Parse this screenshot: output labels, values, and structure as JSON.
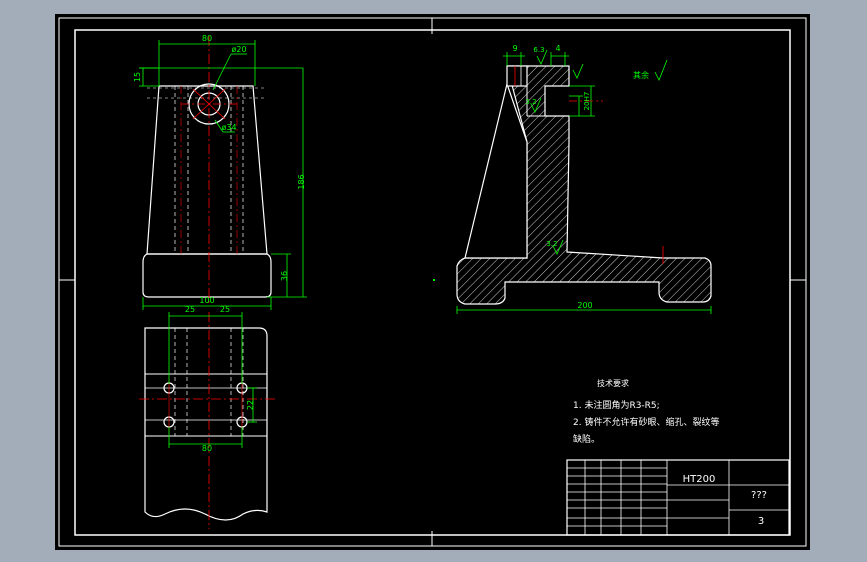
{
  "colors": {
    "background": "#000000",
    "app_background": "#a3acb9",
    "outline": "#ffffff",
    "dimension": "#00ff00",
    "centerline": "#ff0000",
    "hidden_line": "#ffffff"
  },
  "front_view": {
    "dim_top_width": "80",
    "dim_hole": "ø20",
    "dim_left_height": "15",
    "dim_inner_hole": "ø34",
    "dim_total_height": "186",
    "dim_base_height": "36",
    "dim_base_width": "100"
  },
  "top_view": {
    "dim_left": "25",
    "dim_right": "25",
    "dim_right_vertical": "22",
    "dim_bottom": "80"
  },
  "section_view": {
    "dim_9": "9",
    "dim_63": "6.3",
    "dim_4": "4",
    "dim_32_upper": "3.2",
    "dim_20": "20H7",
    "dim_32_lower": "3.2",
    "dim_200": "200",
    "roughness_note": "其余"
  },
  "tech_notes": {
    "title": "技术要求",
    "line1": "1.  未注圆角为R3-R5;",
    "line2": "2.  铸件不允许有砂眼、缩孔、裂纹等",
    "line3": "缺陷。"
  },
  "title_block": {
    "material": "HT200",
    "drawing_name": "???",
    "sheet": "3"
  }
}
